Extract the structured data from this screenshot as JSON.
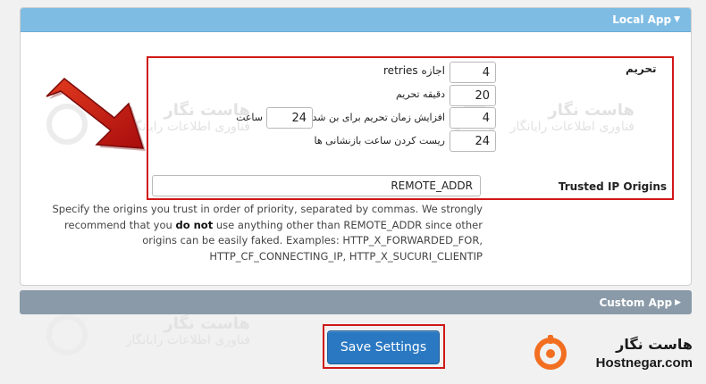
{
  "local_app": {
    "title": "Local App",
    "ban_label": "تحریم",
    "retries": {
      "value": "4",
      "label": "retries اجازه"
    },
    "ban_minutes": {
      "value": "20",
      "label": "دقیقه تحریم"
    },
    "increase": {
      "value": "4",
      "label": "افزایش زمان تحریم برای بن شدگان",
      "hours_value": "24",
      "hours_label": "ساعت"
    },
    "reset": {
      "value": "24",
      "label": "ریست کردن ساعت بازنشانی ها"
    },
    "trusted_label": "Trusted IP Origins",
    "trusted_value": "REMOTE_ADDR",
    "help": {
      "part1": "Specify the origins you trust in order of priority, separated by commas. We strongly recommend that you",
      "bold": "do not",
      "part2": "use anything other than REMOTE_ADDR since other origins can be easily faked. Examples: HTTP_X_FORWARDED_FOR, HTTP_CF_CONNECTING_IP, HTTP_X_SUCURI_CLIENTIP"
    }
  },
  "custom_app": {
    "title": "Custom App"
  },
  "save_button": "Save Settings",
  "watermark": {
    "title": "هاست نگار",
    "subtitle": "فناوری اطلاعات رایانگار"
  },
  "logo": {
    "name": "هاست نگار",
    "domain": "Hostnegar.com"
  },
  "colors": {
    "header": "#7fbce3",
    "custom_bar": "#8a9aa8",
    "button": "#2a78c2",
    "highlight": "#d01818",
    "logo_orange": "#f26f21"
  }
}
